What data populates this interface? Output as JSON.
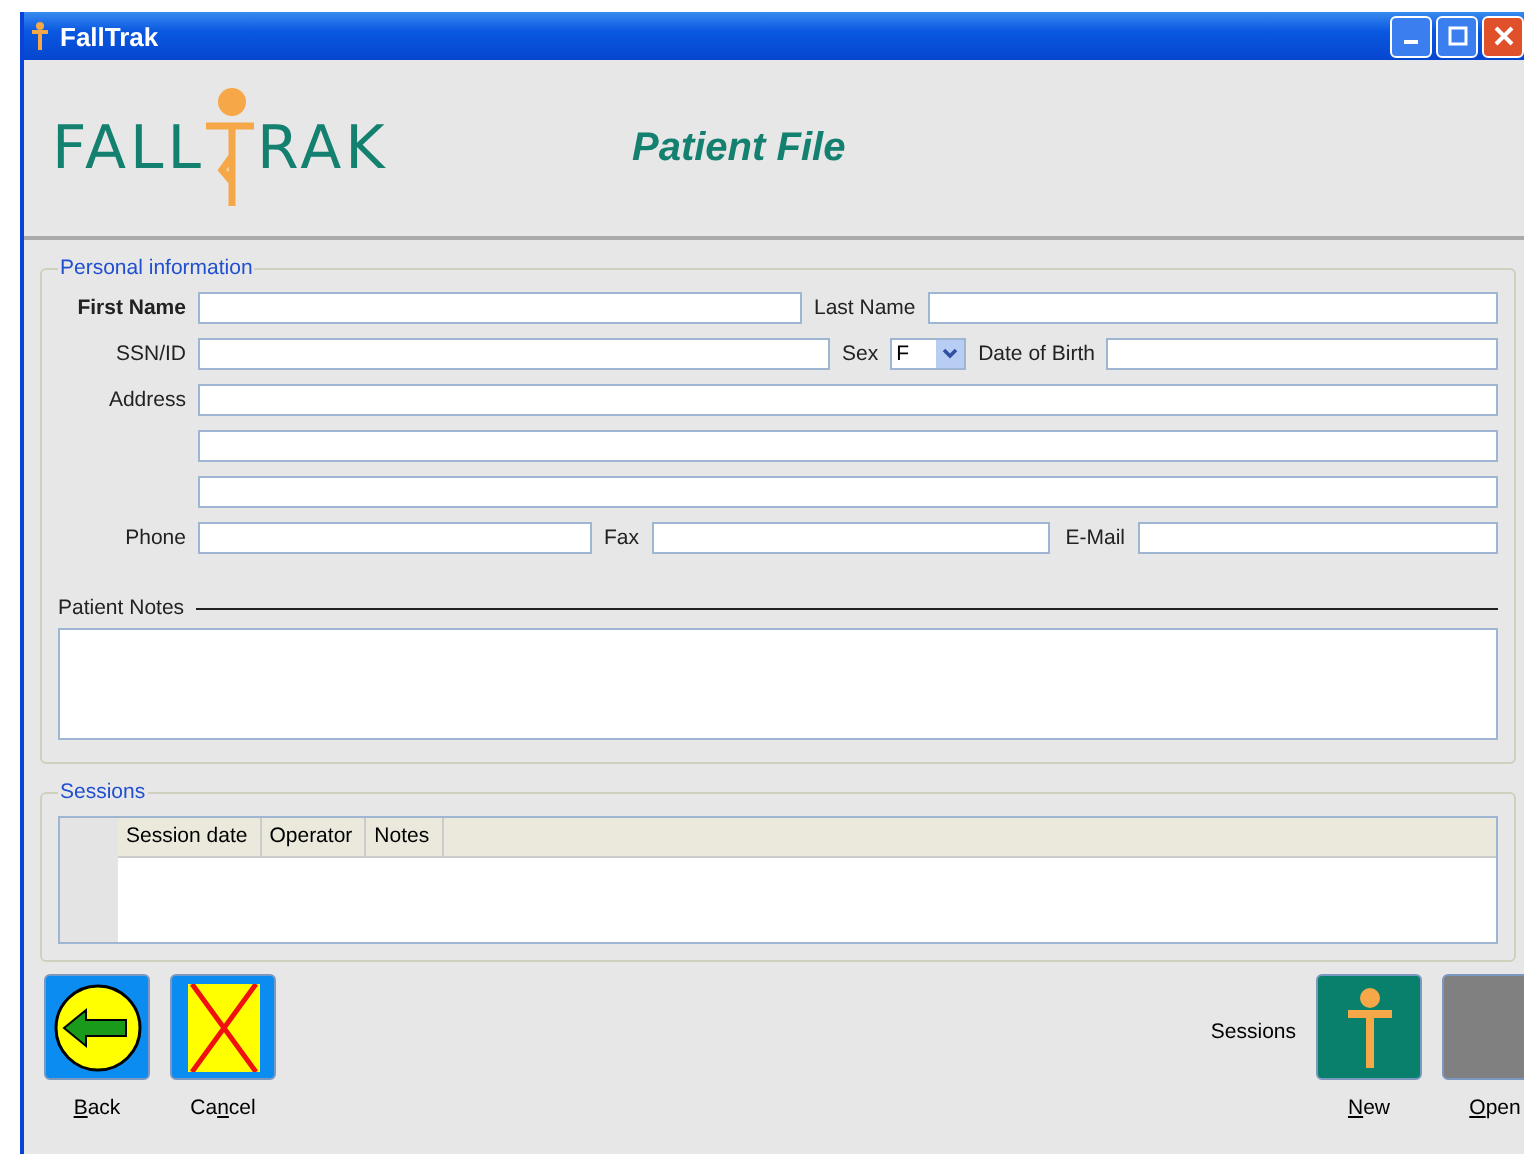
{
  "window": {
    "title": "FallTrak"
  },
  "logo": {
    "left": "FALL",
    "right": "RAK"
  },
  "heading": "Patient File",
  "personal": {
    "legend": "Personal information",
    "first_name": {
      "label": "First Name"
    },
    "last_name": {
      "label": "Last Name"
    },
    "ssn": {
      "label": "SSN/ID"
    },
    "sex": {
      "label": "Sex",
      "value": "F"
    },
    "dob": {
      "label": "Date of Birth"
    },
    "address": {
      "label": "Address"
    },
    "phone": {
      "label": "Phone"
    },
    "fax": {
      "label": "Fax"
    },
    "email": {
      "label": "E-Mail"
    },
    "notes": {
      "label": "Patient Notes"
    }
  },
  "sessions": {
    "legend": "Sessions",
    "columns": [
      "Session date",
      "Operator",
      "Notes"
    ]
  },
  "buttons_left": [
    {
      "kind": "back",
      "key": "B",
      "post": "ack"
    },
    {
      "kind": "cancel",
      "pre": "Ca",
      "key": "n",
      "post": "cel"
    }
  ],
  "sessions_label": "Sessions",
  "buttons_right": [
    {
      "kind": "new",
      "key": "N",
      "post": "ew"
    },
    {
      "kind": "open",
      "key": "O",
      "post": "pen"
    }
  ]
}
